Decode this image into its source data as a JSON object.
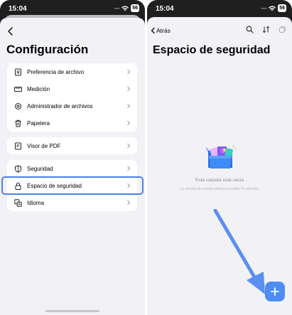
{
  "left": {
    "status": {
      "time": "15:04",
      "battery": "56"
    },
    "title": "Configuración",
    "groups": [
      {
        "items": [
          {
            "label": "Preferencia de archivo",
            "icon": "file-preference-icon"
          },
          {
            "label": "Medición",
            "icon": "ruler-icon"
          },
          {
            "label": "Administrador de archivos",
            "icon": "file-manager-icon"
          },
          {
            "label": "Papelera",
            "icon": "trash-icon"
          }
        ]
      },
      {
        "items": [
          {
            "label": "Visor de PDF",
            "icon": "pdf-viewer-icon"
          }
        ]
      },
      {
        "items": [
          {
            "label": "Seguridad",
            "icon": "shield-icon"
          },
          {
            "label": "Espacio de seguridad",
            "icon": "lock-icon"
          },
          {
            "label": "Idioma",
            "icon": "language-icon"
          }
        ]
      }
    ]
  },
  "right": {
    "status": {
      "time": "15:04",
      "battery": "56"
    },
    "back_label": "Atrás",
    "title": "Espacio de seguridad",
    "empty_title": "Esta carpeta está vacía",
    "empty_subtitle": "La versión de prueba almacena hasta 10 artículos",
    "accent_color": "#4d8df5",
    "highlight_color": "#4a7ff0"
  }
}
